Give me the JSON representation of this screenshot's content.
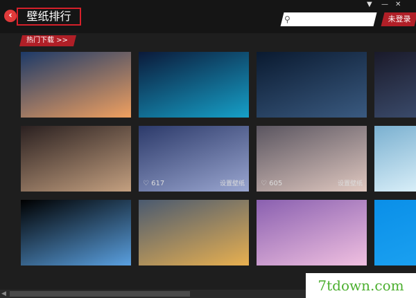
{
  "header": {
    "back_symbol": "‹",
    "title": "壁纸排行",
    "window_controls": [
      "▼",
      "—",
      "✕"
    ]
  },
  "search": {
    "icon": "search-icon",
    "placeholder": "",
    "value": ""
  },
  "account": {
    "login_label": "未登录"
  },
  "section": {
    "tab_label": "热门下载 >>"
  },
  "tiles": [
    {
      "subject": "highway at sunset",
      "colors": [
        "#1d3a68",
        "#f0a060"
      ]
    },
    {
      "subject": "city night skyline",
      "colors": [
        "#0b1a3a",
        "#16a0c8"
      ]
    },
    {
      "subject": "pier under starry sky",
      "colors": [
        "#0a1a30",
        "#3a5a80"
      ]
    },
    {
      "subject": "girl portrait",
      "colors": [
        "#2a2020",
        "#c4a080"
      ]
    },
    {
      "subject": "rock formation at dusk",
      "colors": [
        "#2c3a6a",
        "#9aa6d0"
      ],
      "likes": "617",
      "action": "设置壁纸"
    },
    {
      "subject": "person lying on bed",
      "colors": [
        "#5a5560",
        "#e0c8c0"
      ],
      "likes": "605",
      "action": "设置壁纸"
    },
    {
      "subject": "earth horizon from space",
      "colors": [
        "#000000",
        "#5aa0e0"
      ]
    },
    {
      "subject": "road toward sunset",
      "colors": [
        "#4a5a70",
        "#e8b050"
      ]
    },
    {
      "subject": "purple clouds",
      "colors": [
        "#8a60b0",
        "#f0c0e0"
      ]
    },
    {
      "subject": "partial right column",
      "colors": [
        "#1a1a2a",
        "#3a4a6a"
      ]
    },
    {
      "subject": "partial right column",
      "colors": [
        "#7ab0d0",
        "#d8eef8"
      ]
    },
    {
      "subject": "partial right column",
      "colors": [
        "#0a8fe8",
        "#1aa0f0"
      ]
    }
  ],
  "watermark": {
    "text": "7tdown.com"
  },
  "colors": {
    "accent": "#b01f27",
    "background": "#1e1e1e",
    "watermark": "#4caf2f"
  }
}
